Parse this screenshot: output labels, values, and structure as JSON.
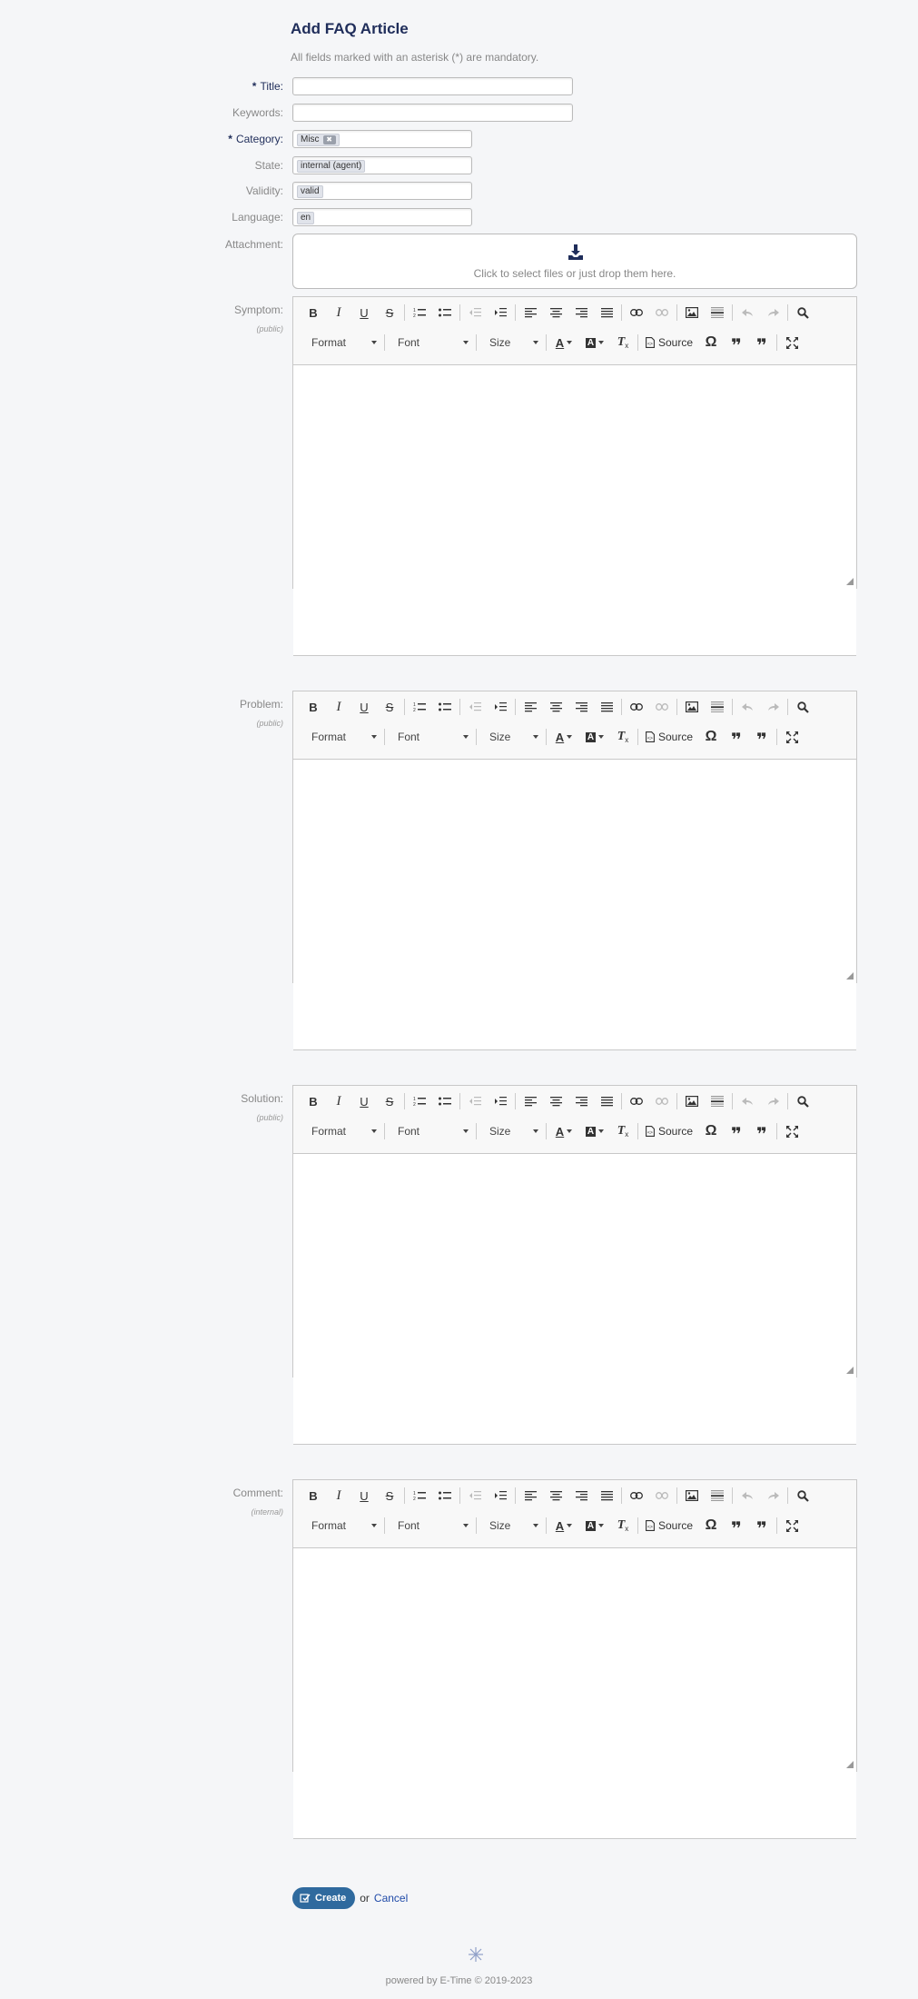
{
  "page": {
    "title": "Add FAQ Article",
    "mandatory_note": "All fields marked with an asterisk (*) are mandatory."
  },
  "fields": {
    "title": {
      "label": "Title:",
      "value": ""
    },
    "keywords": {
      "label": "Keywords:",
      "value": ""
    },
    "category": {
      "label": "Category:",
      "value": "Misc"
    },
    "state": {
      "label": "State:",
      "value": "internal (agent)"
    },
    "validity": {
      "label": "Validity:",
      "value": "valid"
    },
    "language": {
      "label": "Language:",
      "value": "en"
    },
    "attachment": {
      "label": "Attachment:",
      "dropzone_text": "Click to select files or just drop them here."
    }
  },
  "editor": {
    "format_label": "Format",
    "font_label": "Font",
    "size_label": "Size",
    "source_label": "Source"
  },
  "editors": [
    {
      "label": "Symptom:",
      "sublabel": "(public)"
    },
    {
      "label": "Problem:",
      "sublabel": "(public)"
    },
    {
      "label": "Solution:",
      "sublabel": "(public)"
    },
    {
      "label": "Comment:",
      "sublabel": "(internal)"
    }
  ],
  "actions": {
    "create_label": "Create",
    "or_text": "or",
    "cancel_label": "Cancel"
  },
  "footer": {
    "text": "powered by E-Time © 2019-2023"
  },
  "colors": {
    "accent": "#1f2d5a",
    "button": "#2f6a9e",
    "link": "#1f4aa8"
  }
}
